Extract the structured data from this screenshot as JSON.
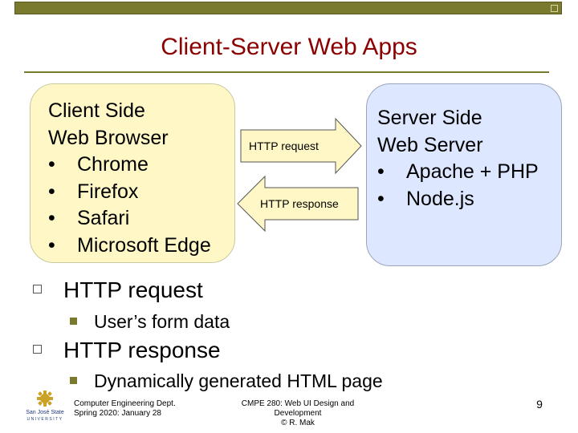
{
  "slide": {
    "title": "Client-Server Web Apps",
    "client": {
      "heading1": "Client Side",
      "heading2": "Web Browser",
      "items": [
        "Chrome",
        "Firefox",
        "Safari",
        "Microsoft Edge"
      ]
    },
    "server": {
      "heading1": "Server Side",
      "heading2": "Web Server",
      "items": [
        "Apache + PHP",
        "Node.js"
      ]
    },
    "arrows": {
      "request_label": "HTTP request",
      "response_label": "HTTP response"
    },
    "bullets": [
      {
        "text": "HTTP request",
        "sub": "User’s form data"
      },
      {
        "text": "HTTP response",
        "sub": "Dynamically generated HTML page"
      }
    ],
    "bullet_glyph": "•",
    "footer": {
      "left_line1": "Computer Engineering Dept.",
      "left_line2": "Spring 2020: January 28",
      "mid_line1": "CMPE 280: Web UI Design and Development",
      "mid_line2": "© R. Mak",
      "page_number": "9"
    },
    "logo_text": {
      "line1": "San José State",
      "line2": "UNIVERSITY"
    },
    "colors": {
      "title": "#8b0000",
      "accent": "#7a7a2e",
      "client_fill": "#fff8c6",
      "server_fill": "#dde7ff",
      "arrow_fill": "#fff8c6"
    }
  }
}
